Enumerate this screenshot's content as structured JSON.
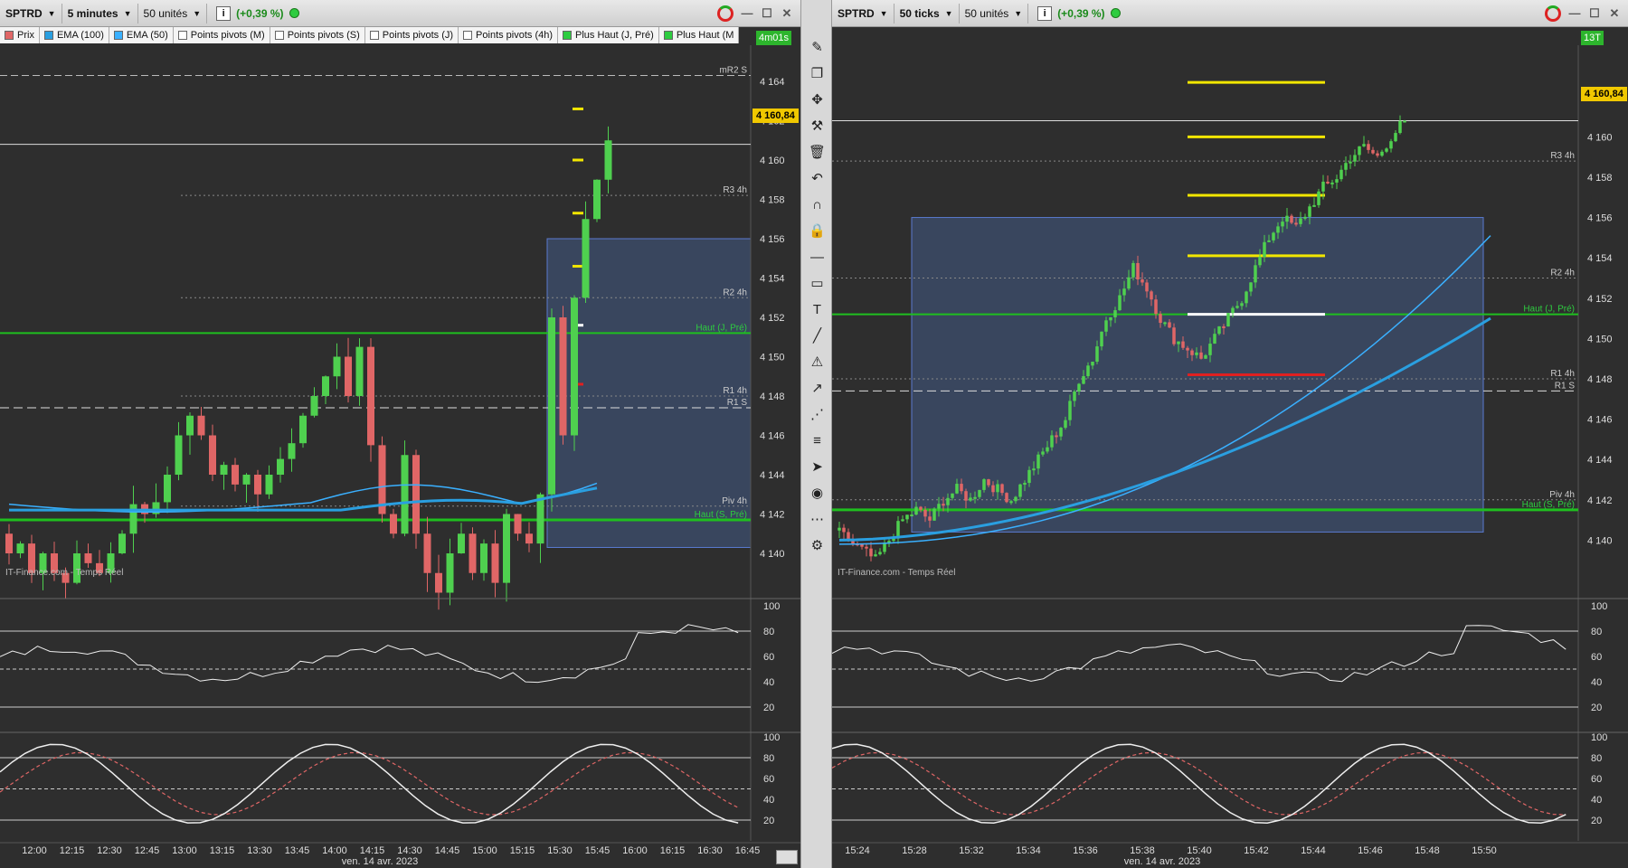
{
  "left": {
    "symbol": "SPTRD",
    "interval": "5 minutes",
    "units": "50 unités",
    "change": "(+0,39 %)",
    "legend": [
      "Prix",
      "EMA (100)",
      "EMA (50)",
      "Points pivots (M)",
      "Points pivots (S)",
      "Points pivots (J)",
      "Points pivots (4h)",
      "Plus Haut (J, Pré)",
      "Plus Haut (M"
    ],
    "timer": "4m01s",
    "price_tag": "4 160,84",
    "watermark": "IT-Finance.com - Temps Réel",
    "date_label": "ven. 14 avr. 2023",
    "y_ticks": [
      "4 164",
      "4 162",
      "4 160",
      "4 158",
      "4 156",
      "4 154",
      "4 152",
      "4 150",
      "4 148",
      "4 146",
      "4 144",
      "4 142",
      "4 140"
    ],
    "x_ticks": [
      "12:00",
      "12:15",
      "12:30",
      "12:45",
      "13:00",
      "13:15",
      "13:30",
      "13:45",
      "14:00",
      "14:15",
      "14:30",
      "14:45",
      "15:00",
      "15:15",
      "15:30",
      "15:45",
      "16:00",
      "16:15",
      "16:30",
      "16:45"
    ],
    "levels": [
      "mR2 S",
      "R3 4h",
      "R2 4h",
      "Haut (J, Pré)",
      "R1 4h",
      "R1 S",
      "Piv 4h",
      "Haut (S, Pré)"
    ]
  },
  "right": {
    "symbol": "SPTRD",
    "interval": "50 ticks",
    "units": "50 unités",
    "change": "(+0,39 %)",
    "timer": "13T",
    "price_tag": "4 160,84",
    "watermark": "IT-Finance.com - Temps Réel",
    "date_label": "ven. 14 avr. 2023",
    "y_ticks": [
      "4 162",
      "4 160",
      "4 158",
      "4 156",
      "4 154",
      "4 152",
      "4 150",
      "4 148",
      "4 146",
      "4 144",
      "4 142",
      "4 140"
    ],
    "x_ticks": [
      "15:24",
      "15:28",
      "15:32",
      "15:34",
      "15:36",
      "15:38",
      "15:40",
      "15:42",
      "15:44",
      "15:46",
      "15:48",
      "15:50"
    ],
    "levels": [
      "R3 4h",
      "R2 4h",
      "Haut (J, Pré)",
      "R1 4h",
      "R1 S",
      "Piv 4h",
      "Haut (S, Pré)"
    ]
  },
  "osc_ticks": [
    "100",
    "80",
    "60",
    "40",
    "20"
  ],
  "colors": {
    "up": "#4fd04f",
    "down": "#e06666",
    "ema100": "#2a9fe0",
    "ema50": "#3ab0ff",
    "level_green": "#1fbf1f",
    "pivot_yellow": "#f2e600",
    "zone": "#3b4a66"
  },
  "icons": [
    "pencil-icon",
    "copy-icon",
    "move-icon",
    "tools-icon",
    "trash-icon",
    "undo-icon",
    "magnet-icon",
    "lock-icon",
    "hline-icon",
    "ruler-icon",
    "text-icon",
    "trendline-icon",
    "alert-icon",
    "arrow-icon",
    "points-icon",
    "fib-icon",
    "cursor-icon",
    "eye-icon",
    "measure-icon",
    "settings-icon"
  ]
}
